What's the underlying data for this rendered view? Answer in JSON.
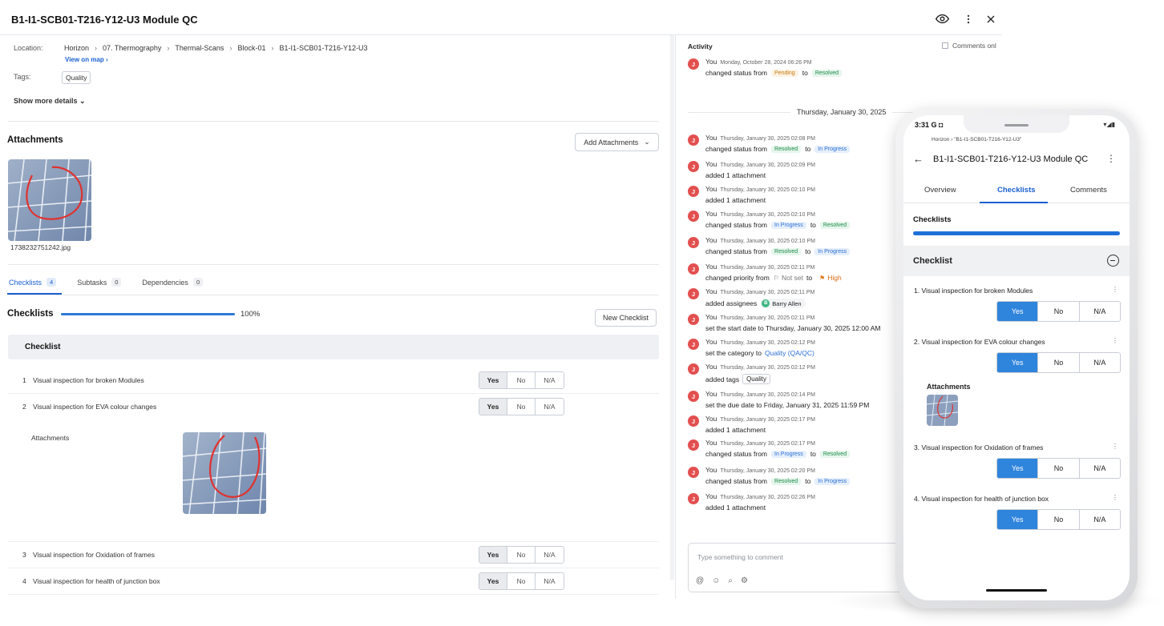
{
  "header": {
    "title": "B1-I1-SCB01-T216-Y12-U3 Module QC"
  },
  "details": {
    "location_label": "Location:",
    "breadcrumbs": [
      "Horizon",
      "07. Thermography",
      "Thermal-Scans",
      "Block-01",
      "B1-I1-SCB01-T216-Y12-U3"
    ],
    "view_on_map": "View on map",
    "tags_label": "Tags:",
    "tag": "Quality",
    "show_more": "Show more details"
  },
  "attachments": {
    "title": "Attachments",
    "add_button": "Add Attachments",
    "file_name": "1738232751242.jpg"
  },
  "tabs": [
    {
      "label": "Checklists",
      "count": "4"
    },
    {
      "label": "Subtasks",
      "count": "0"
    },
    {
      "label": "Dependencies",
      "count": "0"
    }
  ],
  "checklists": {
    "title": "Checklists",
    "progress": 1.0,
    "progress_label": "100%",
    "new_button": "New Checklist",
    "checklist_title": "Checklist",
    "options": [
      "Yes",
      "No",
      "N/A"
    ],
    "attachments_label": "Attachments",
    "items": [
      {
        "num": "1",
        "text": "Visual inspection for broken Modules",
        "selected": "Yes"
      },
      {
        "num": "2",
        "text": "Visual inspection for EVA colour changes",
        "selected": "Yes"
      },
      {
        "num": "3",
        "text": "Visual inspection for Oxidation of frames",
        "selected": "Yes"
      },
      {
        "num": "4",
        "text": "Visual inspection for health of junction box",
        "selected": "Yes"
      }
    ]
  },
  "activity": {
    "title": "Activity",
    "comments_only": "Comments onl",
    "date_separator": "Thursday, January 30, 2025",
    "comment_placeholder": "Type something to comment",
    "entries": [
      {
        "user": "You",
        "ts": "Monday, October 28, 2024 06:26 PM",
        "pre": "changed status from",
        "from": "Pending",
        "mid": "to",
        "to": "Resolved"
      },
      {
        "user": "You",
        "ts": "Thursday, January 30, 2025 02:08 PM",
        "pre": "changed status from",
        "from": "Resolved",
        "mid": "to",
        "to": "In Progress"
      },
      {
        "user": "You",
        "ts": "Thursday, January 30, 2025 02:09 PM",
        "text": "added 1 attachment"
      },
      {
        "user": "You",
        "ts": "Thursday, January 30, 2025 02:10 PM",
        "text": "added 1 attachment"
      },
      {
        "user": "You",
        "ts": "Thursday, January 30, 2025 02:10 PM",
        "pre": "changed status from",
        "from": "In Progress",
        "mid": "to",
        "to": "Resolved"
      },
      {
        "user": "You",
        "ts": "Thursday, January 30, 2025 02:10 PM",
        "pre": "changed status from",
        "from": "Resolved",
        "mid": "to",
        "to": "In Progress"
      },
      {
        "user": "You",
        "ts": "Thursday, January 30, 2025 02:11 PM",
        "pre": "changed priority from",
        "prio_from": "Not set",
        "mid": "to",
        "prio_to": "High"
      },
      {
        "user": "You",
        "ts": "Thursday, January 30, 2025 02:11 PM",
        "pre": "added assignees",
        "assignee_initial": "B",
        "assignee": "Barry Allen"
      },
      {
        "user": "You",
        "ts": "Thursday, January 30, 2025 02:11 PM",
        "text": "set the start date to Thursday, January 30, 2025 12:00 AM"
      },
      {
        "user": "You",
        "ts": "Thursday, January 30, 2025 02:12 PM",
        "pre": "set the category to",
        "category": "Quality (QA/QC)"
      },
      {
        "user": "You",
        "ts": "Thursday, January 30, 2025 02:12 PM",
        "pre": "added tags",
        "tag": "Quality"
      },
      {
        "user": "You",
        "ts": "Thursday, January 30, 2025 02:14 PM",
        "text": "set the due date to Friday, January 31, 2025 11:59 PM"
      },
      {
        "user": "You",
        "ts": "Thursday, January 30, 2025 02:17 PM",
        "text": "added 1 attachment"
      },
      {
        "user": "You",
        "ts": "Thursday, January 30, 2025 02:17 PM",
        "pre": "changed status from",
        "from": "In Progress",
        "mid": "to",
        "to": "Resolved"
      },
      {
        "user": "You",
        "ts": "Thursday, January 30, 2025 02:20 PM",
        "pre": "changed status from",
        "from": "Resolved",
        "mid": "to",
        "to": "In Progress"
      },
      {
        "user": "You",
        "ts": "Thursday, January 30, 2025 02:26 PM",
        "text": "added 1 attachment"
      }
    ]
  },
  "mobile": {
    "status_time": "3:31",
    "breadcrumb_root": "Horizon",
    "breadcrumb_leaf": "\"B1-I1-SCB01-T216-Y12-U3\"",
    "title": "B1-I1-SCB01-T216-Y12-U3 Module QC",
    "tabs": [
      "Overview",
      "Checklists",
      "Comments"
    ],
    "section_title": "Checklists",
    "progress": 1.0,
    "checklist_title": "Checklist",
    "attachments_label": "Attachments",
    "options": [
      "Yes",
      "No",
      "N/A"
    ],
    "items": [
      {
        "text": "1.  Visual inspection for broken Modules",
        "selected": "Yes"
      },
      {
        "text": "2.  Visual inspection for EVA colour changes",
        "selected": "Yes"
      },
      {
        "text": "3.  Visual inspection for Oxidation of frames",
        "selected": "Yes"
      },
      {
        "text": "4.  Visual inspection for health of junction box",
        "selected": "Yes"
      }
    ]
  },
  "colors": {
    "accent": "#1a5fd0",
    "avatar": "#e2504f",
    "resolved": "#1d8a4a",
    "in_progress": "#2b6fd6",
    "pending": "#c77b12",
    "mobile_selected": "#2f84dc"
  }
}
